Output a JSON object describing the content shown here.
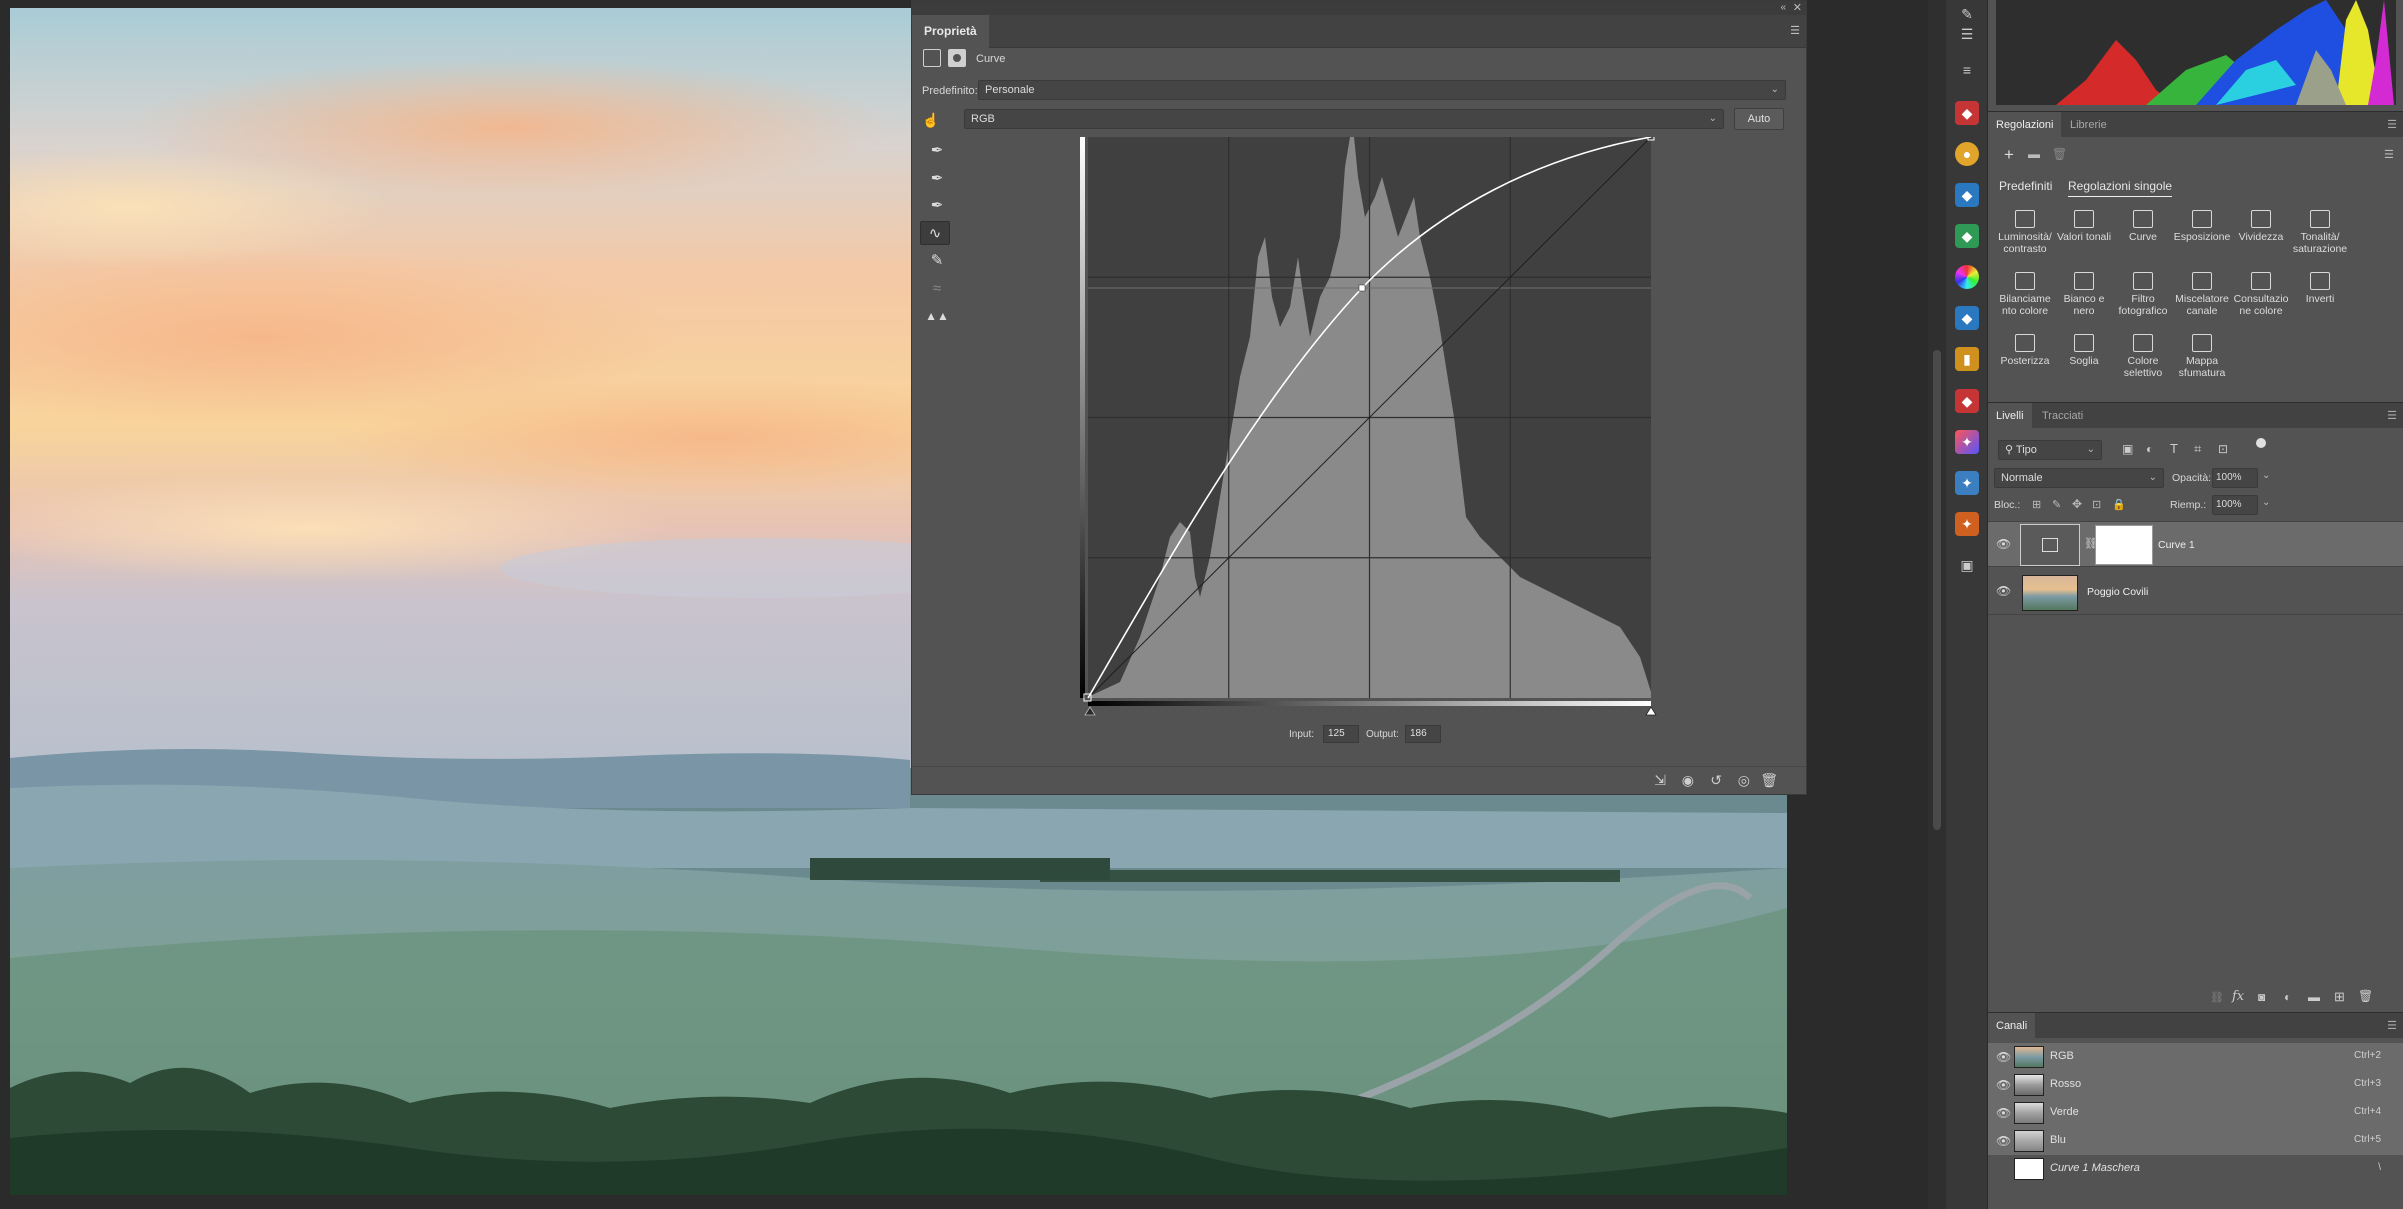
{
  "properties": {
    "tab": "Proprietà",
    "kind_label": "Curve",
    "preset_label": "Predefinito:",
    "preset_value": "Personale",
    "channel_value": "RGB",
    "auto_button": "Auto",
    "input_label": "Input:",
    "input_value": "125",
    "output_label": "Output:",
    "output_value": "186",
    "tools": [
      "sample-shadows-eyedropper-icon",
      "sample-midtones-eyedropper-icon",
      "sample-highlights-eyedropper-icon",
      "curve-points-icon",
      "pencil-icon",
      "smooth-icon",
      "clipping-warning-icon"
    ]
  },
  "adjustments": {
    "tabs": [
      "Regolazioni",
      "Librerie"
    ],
    "sub_tabs": [
      "Predefiniti",
      "Regolazioni singole"
    ],
    "items": [
      [
        "Luminosità/",
        "contrasto"
      ],
      [
        "Valori tonali",
        ""
      ],
      [
        "Curve",
        ""
      ],
      [
        "Esposizione",
        ""
      ],
      [
        "Vividezza",
        ""
      ],
      [
        "Tonalità/",
        "saturazione"
      ],
      [
        "Bilanciame",
        "nto colore"
      ],
      [
        "Bianco e",
        "nero"
      ],
      [
        "Filtro",
        "fotografico"
      ],
      [
        "Miscelatore",
        "canale"
      ],
      [
        "Consultazio",
        "ne colore"
      ],
      [
        "Inverti",
        ""
      ],
      [
        "Posterizza",
        ""
      ],
      [
        "Soglia",
        ""
      ],
      [
        "Colore",
        "selettivo"
      ],
      [
        "Mappa",
        "sfumatura"
      ]
    ]
  },
  "layers": {
    "tabs": [
      "Livelli",
      "Tracciati"
    ],
    "filter_value": "Tipo",
    "blend_mode": "Normale",
    "opacity_label": "Opacità:",
    "opacity_value": "100%",
    "lock_label": "Bloc.:",
    "fill_label": "Riemp.:",
    "fill_value": "100%",
    "rows": [
      {
        "name": "Curve 1"
      },
      {
        "name": "Poggio Covili"
      }
    ]
  },
  "channels": {
    "tab": "Canali",
    "rows": [
      {
        "name": "RGB",
        "shortcut": "Ctrl+2"
      },
      {
        "name": "Rosso",
        "shortcut": "Ctrl+3"
      },
      {
        "name": "Verde",
        "shortcut": "Ctrl+4"
      },
      {
        "name": "Blu",
        "shortcut": "Ctrl+5"
      },
      {
        "name": "Curve 1 Maschera",
        "shortcut": "\\"
      }
    ]
  },
  "colors": {
    "panel_bg": "#535353",
    "dark_bg": "#2b2b2b",
    "accent_red": "#d63b3b",
    "accent_blue": "#2f7fc1"
  }
}
